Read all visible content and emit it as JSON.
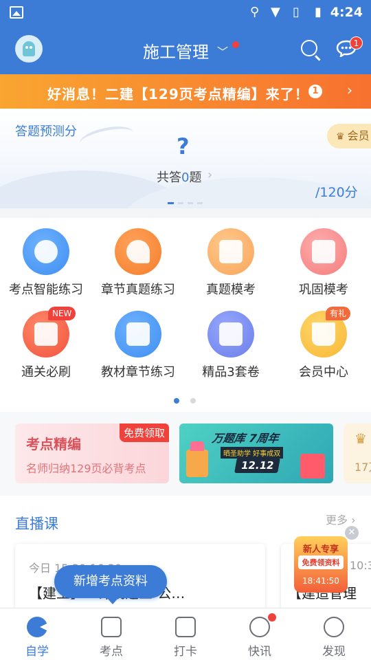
{
  "status_bar": {
    "time": "4:24"
  },
  "header": {
    "title": "施工管理",
    "message_badge": "1"
  },
  "notice": {
    "text": "好消息！二建【129页考点精编】来了！",
    "count": "1"
  },
  "score_card": {
    "label": "答题预测分",
    "score": "?",
    "answered_prefix": "共答",
    "answered_count": "0",
    "answered_suffix": "题",
    "out_of": "/120分",
    "vip_label": "会员"
  },
  "grid": {
    "items": [
      {
        "label": "考点智能练习",
        "icon": "clock-icon",
        "color": "#3e8ef0"
      },
      {
        "label": "章节真题练习",
        "icon": "head-gear-icon",
        "color": "#f57e2b"
      },
      {
        "label": "真题模考",
        "icon": "document-icon",
        "color": "#f9a45a"
      },
      {
        "label": "巩固模考",
        "icon": "checklist-icon",
        "color": "#f47d7d"
      },
      {
        "label": "通关必刷",
        "icon": "500-scroll-icon",
        "color": "#f0523c",
        "tag": "NEW"
      },
      {
        "label": "教材章节练习",
        "icon": "book-icon",
        "color": "#3e8ef0"
      },
      {
        "label": "精品3套卷",
        "icon": "papers-icon",
        "color": "#6a7ee6"
      },
      {
        "label": "会员中心",
        "icon": "crown-icon",
        "color": "#f7b733",
        "tag": "有礼"
      }
    ]
  },
  "banners": {
    "b1_title": "考点精编",
    "b1_sub": "名师归纳129页必背考点",
    "b1_tag": "免费领取",
    "b2_title": "万题库 7周年",
    "b2_sub": "晒圣助学 好事成双",
    "b2_date": "12.12",
    "b3_text": "17万"
  },
  "live": {
    "title": "直播课",
    "more": "更多",
    "card1_time": "今日 15:30-16:30",
    "card1_name": "【建工】…计成之三-公…",
    "card2_time": "10:3",
    "card2_name": "【建造管理"
  },
  "pill": "新增考点资料",
  "newbie": {
    "line1": "新人专享",
    "line2": "免费领资料",
    "countdown": "18:41:50"
  },
  "tabs": [
    {
      "label": "自学"
    },
    {
      "label": "考点"
    },
    {
      "label": "打卡"
    },
    {
      "label": "快讯"
    },
    {
      "label": "发现"
    }
  ]
}
